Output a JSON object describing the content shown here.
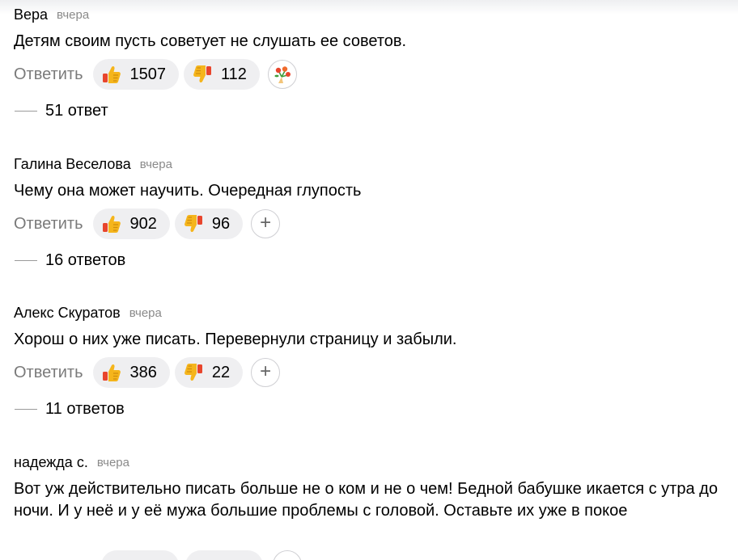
{
  "comments": [
    {
      "author": "Вера",
      "time": "вчера",
      "text": "Детям своим пусть советует не слушать ее советов.",
      "reply_label": "Ответить",
      "likes": "1507",
      "dislikes": "112",
      "extra_reaction": "flower-icon",
      "replies_label": "51 ответ"
    },
    {
      "author": "Галина Веселова",
      "time": "вчера",
      "text": "Чему она может научить. Очередная глупость",
      "reply_label": "Ответить",
      "likes": "902",
      "dislikes": "96",
      "extra_reaction": "plus-icon",
      "replies_label": "16 ответов"
    },
    {
      "author": "Алекс Скуратов",
      "time": "вчера",
      "text": "Хорош о них уже писать. Перевернули страницу и забыли.",
      "reply_label": "Ответить",
      "likes": "386",
      "dislikes": "22",
      "extra_reaction": "plus-icon",
      "replies_label": "11 ответов"
    },
    {
      "author": "надежда с.",
      "time": "вчера",
      "text": "Вот уж действительно писать больше не о ком и не о чем! Бедной бабушке икается с утра до ночи. И у неё и у её мужа большие проблемы с головой. Оставьте их уже в покое"
    }
  ],
  "colors": {
    "text": "#000000",
    "muted": "#7a7a7a",
    "time": "#8a8a8a",
    "pill_bg": "#efeff1",
    "thumb_yellow": "#f5b51c",
    "thumb_red": "#e8452c"
  }
}
